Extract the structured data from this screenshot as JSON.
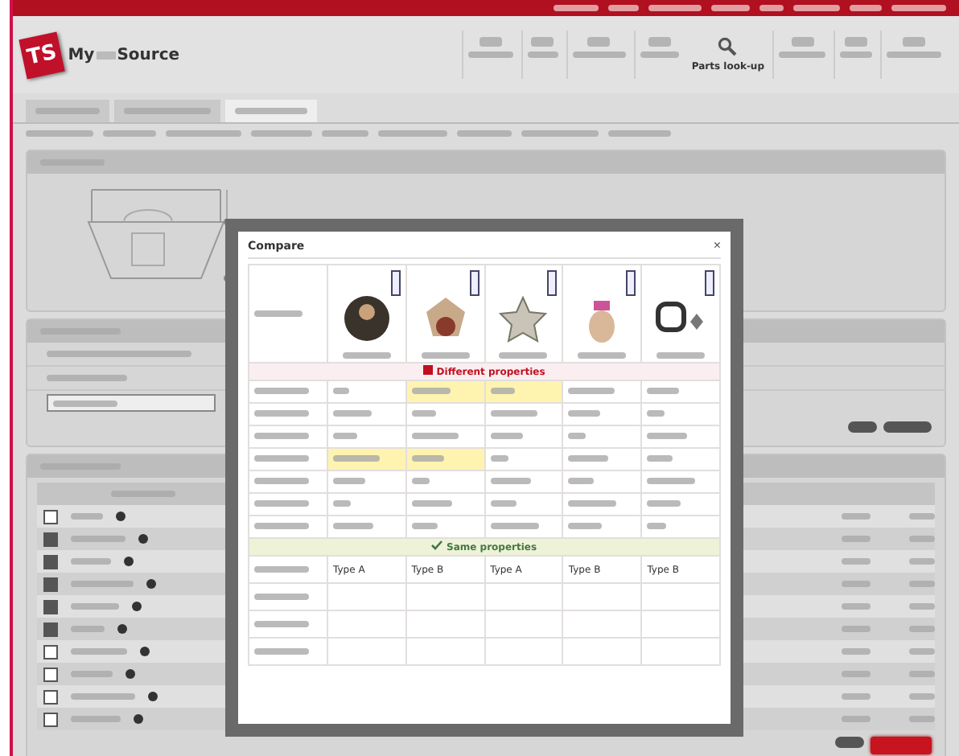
{
  "header": {
    "logo_mark": "TS",
    "logo_text_start": "My",
    "logo_text_end": "Source",
    "parts_lookup": "Parts look-up"
  },
  "tabs": [
    {
      "selected": false
    },
    {
      "selected": false
    },
    {
      "selected": true
    }
  ],
  "compare": {
    "title": "Compare",
    "close": "×",
    "different_heading": "Different properties",
    "same_heading": "Same properties",
    "products": [
      {
        "kind": "dark"
      },
      {
        "kind": "light"
      },
      {
        "kind": "star"
      },
      {
        "kind": "bottle"
      },
      {
        "kind": "ring"
      }
    ],
    "different_rows": [
      {
        "highlighted": [
          false,
          true,
          true,
          false,
          false
        ]
      },
      {
        "highlighted": [
          false,
          false,
          false,
          false,
          false
        ]
      },
      {
        "highlighted": [
          false,
          false,
          false,
          false,
          false
        ]
      },
      {
        "highlighted": [
          true,
          true,
          false,
          false,
          false
        ]
      },
      {
        "highlighted": [
          false,
          false,
          false,
          false,
          false
        ]
      },
      {
        "highlighted": [
          false,
          false,
          false,
          false,
          false
        ]
      },
      {
        "highlighted": [
          false,
          false,
          false,
          false,
          false
        ]
      }
    ],
    "same_rows": [
      {
        "values": [
          "Type A",
          "Type B",
          "Type A",
          "Type B",
          "Type B"
        ]
      },
      {
        "values": []
      },
      {
        "values": []
      },
      {
        "values": []
      }
    ]
  },
  "results": {
    "rows": [
      {
        "checked": false
      },
      {
        "checked": true
      },
      {
        "checked": true
      },
      {
        "checked": true
      },
      {
        "checked": true
      },
      {
        "checked": true
      },
      {
        "checked": false
      },
      {
        "checked": false
      },
      {
        "checked": false
      },
      {
        "checked": false
      }
    ]
  }
}
